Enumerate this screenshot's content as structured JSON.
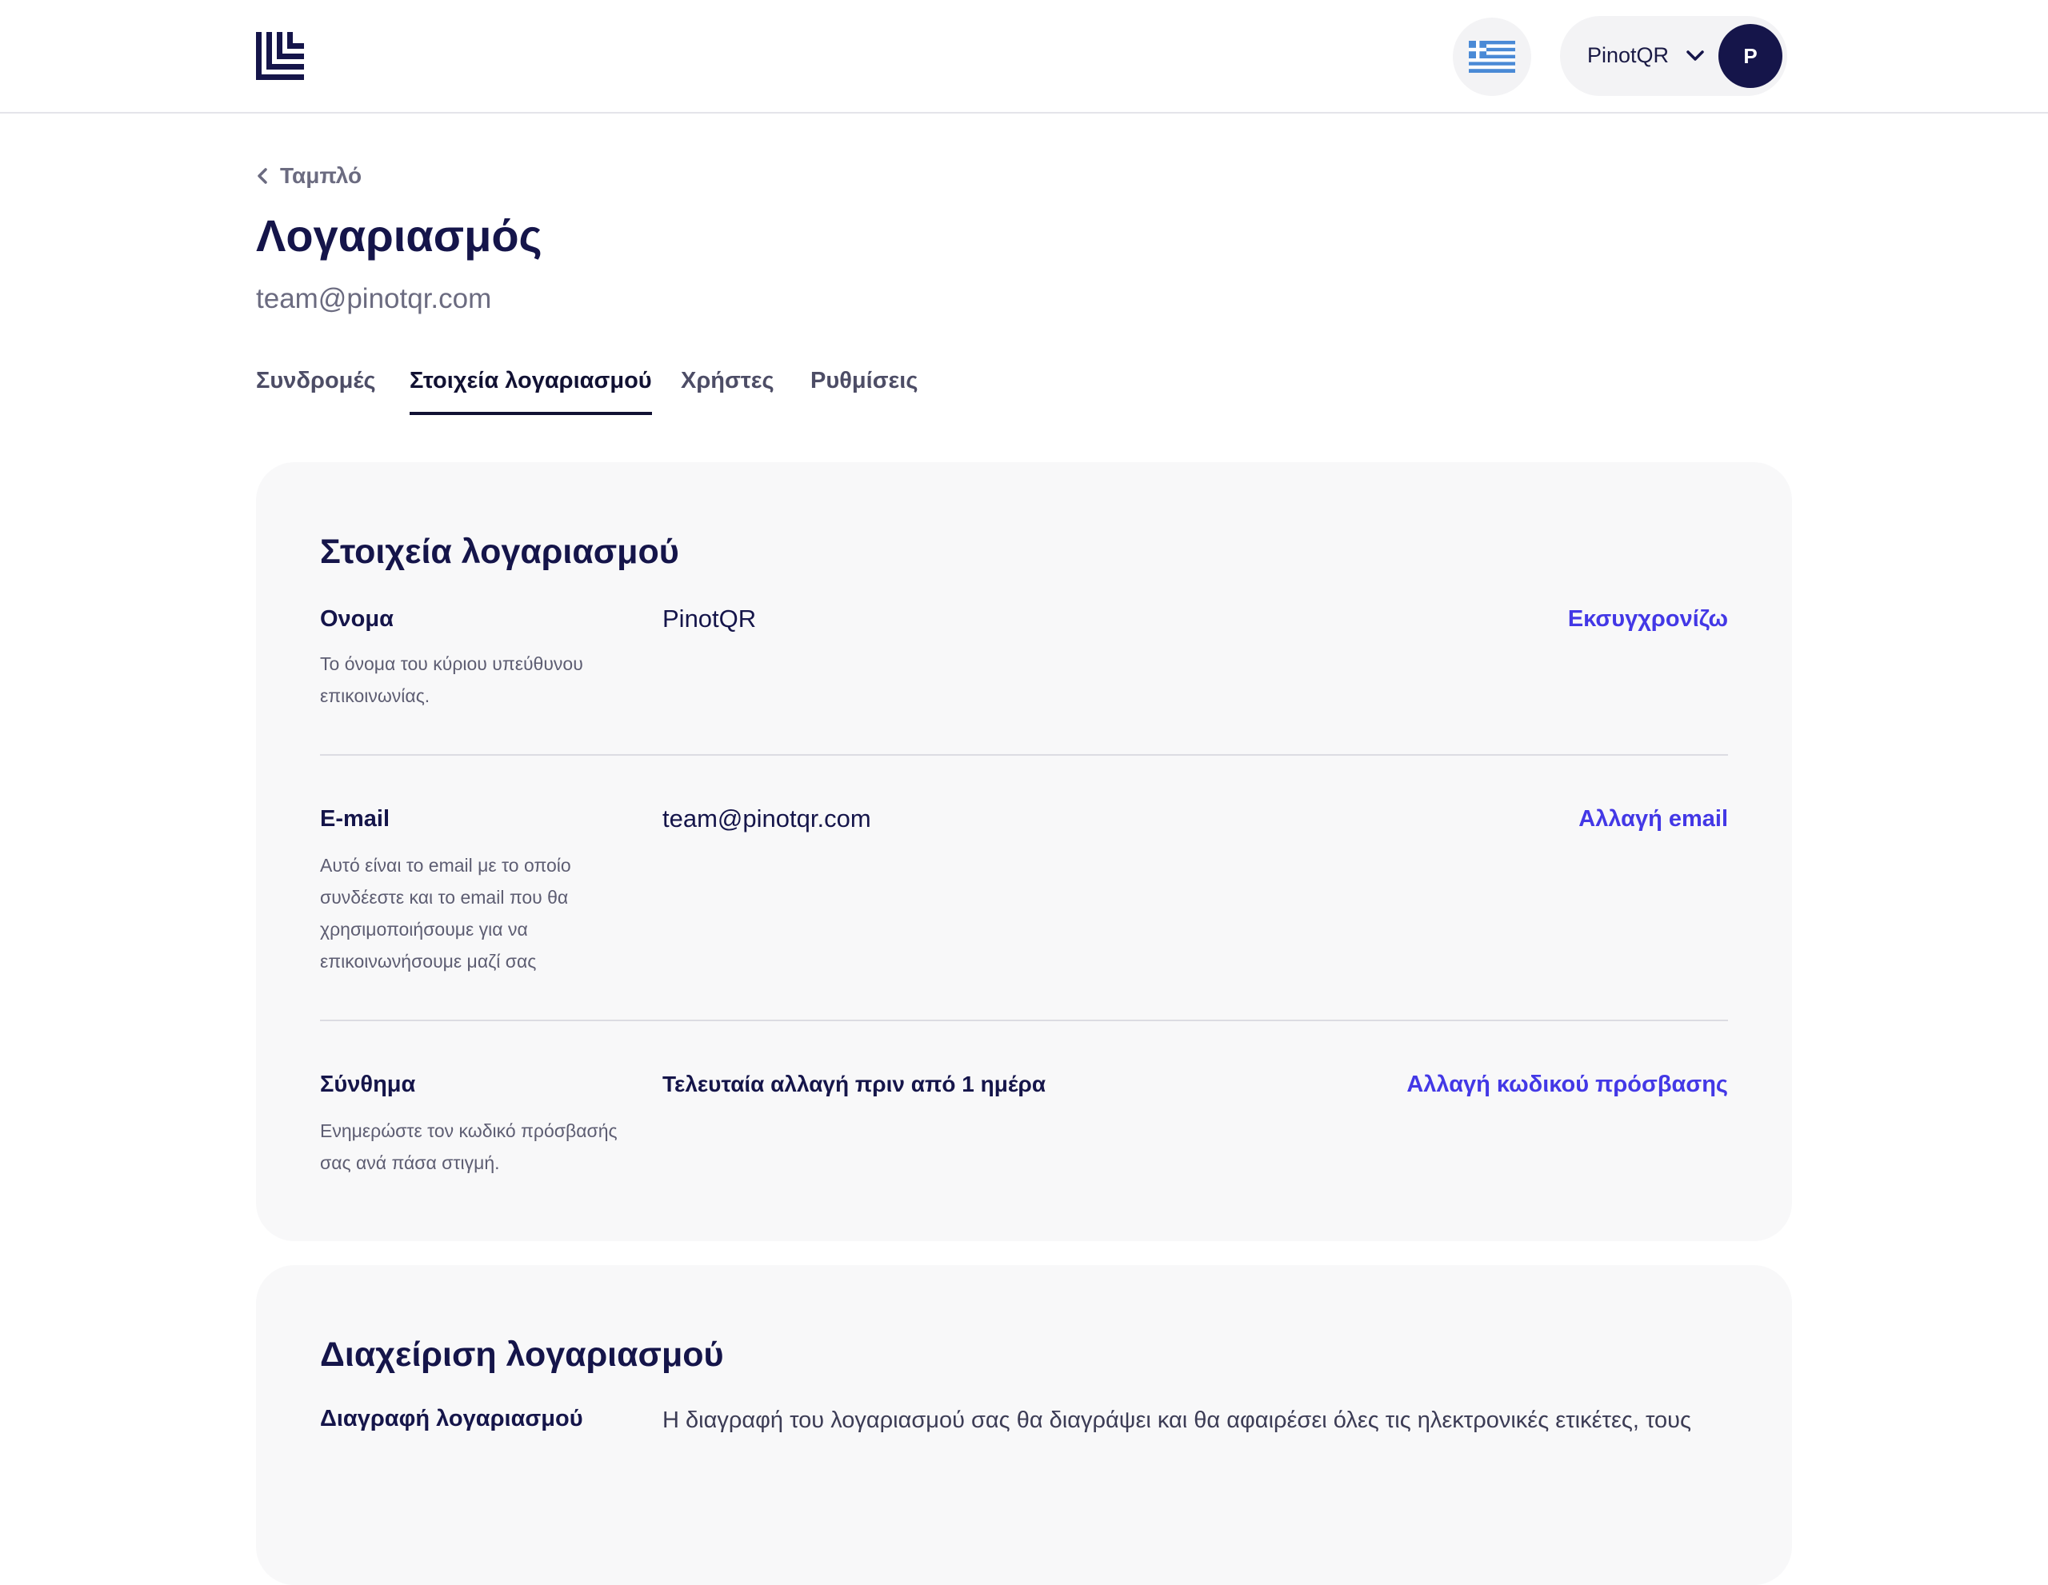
{
  "header": {
    "logo_icon": "brand-logo-icon",
    "language_icon": "greek-flag-icon",
    "account_name": "PinotQR",
    "account_chevron_icon": "chevron-down-icon",
    "avatar_initial": "P"
  },
  "breadcrumb": {
    "back_icon": "chevron-left-icon",
    "label": "Ταμπλό"
  },
  "page": {
    "title": "Λογαριασμός",
    "subtitle": "team@pinotqr.com"
  },
  "tabs": [
    {
      "label": "Συνδρομές",
      "active": false
    },
    {
      "label": "Στοιχεία λογαριασμού",
      "active": true
    },
    {
      "label": "Χρήστες",
      "active": false
    },
    {
      "label": "Ρυθμίσεις",
      "active": false
    }
  ],
  "account_details": {
    "title": "Στοιχεία λογαριασμού",
    "rows": [
      {
        "label": "Ονομα",
        "description": "Το όνομα του κύριου υπεύθυνου επικοινωνίας.",
        "value": "PinotQR",
        "action": "Εκσυγχρονίζω"
      },
      {
        "label": "E-mail",
        "description": "Αυτό είναι το email με το οποίο συνδέεστε και το email που θα χρησιμοποιήσουμε για να επικοινωνήσουμε μαζί σας",
        "value": "team@pinotqr.com",
        "action": "Αλλαγή email"
      },
      {
        "label": "Σύνθημα",
        "description": "Ενημερώστε τον κωδικό πρόσβασής σας ανά πάσα στιγμή.",
        "value": "Τελευταία αλλαγή πριν από 1 ημέρα",
        "action": "Αλλαγή κωδικού πρόσβασης"
      }
    ]
  },
  "account_management": {
    "title": "Διαχείριση λογαριασμού",
    "delete_label": "Διαγραφή λογαριασμού",
    "delete_text": "Η διαγραφή του λογαριασμού σας θα διαγράψει και θα αφαιρέσει όλες τις ηλεκτρονικές ετικέτες, τους"
  },
  "colors": {
    "navy": "#15154a",
    "link": "#4338e6",
    "card_bg": "#f8f8f9"
  }
}
